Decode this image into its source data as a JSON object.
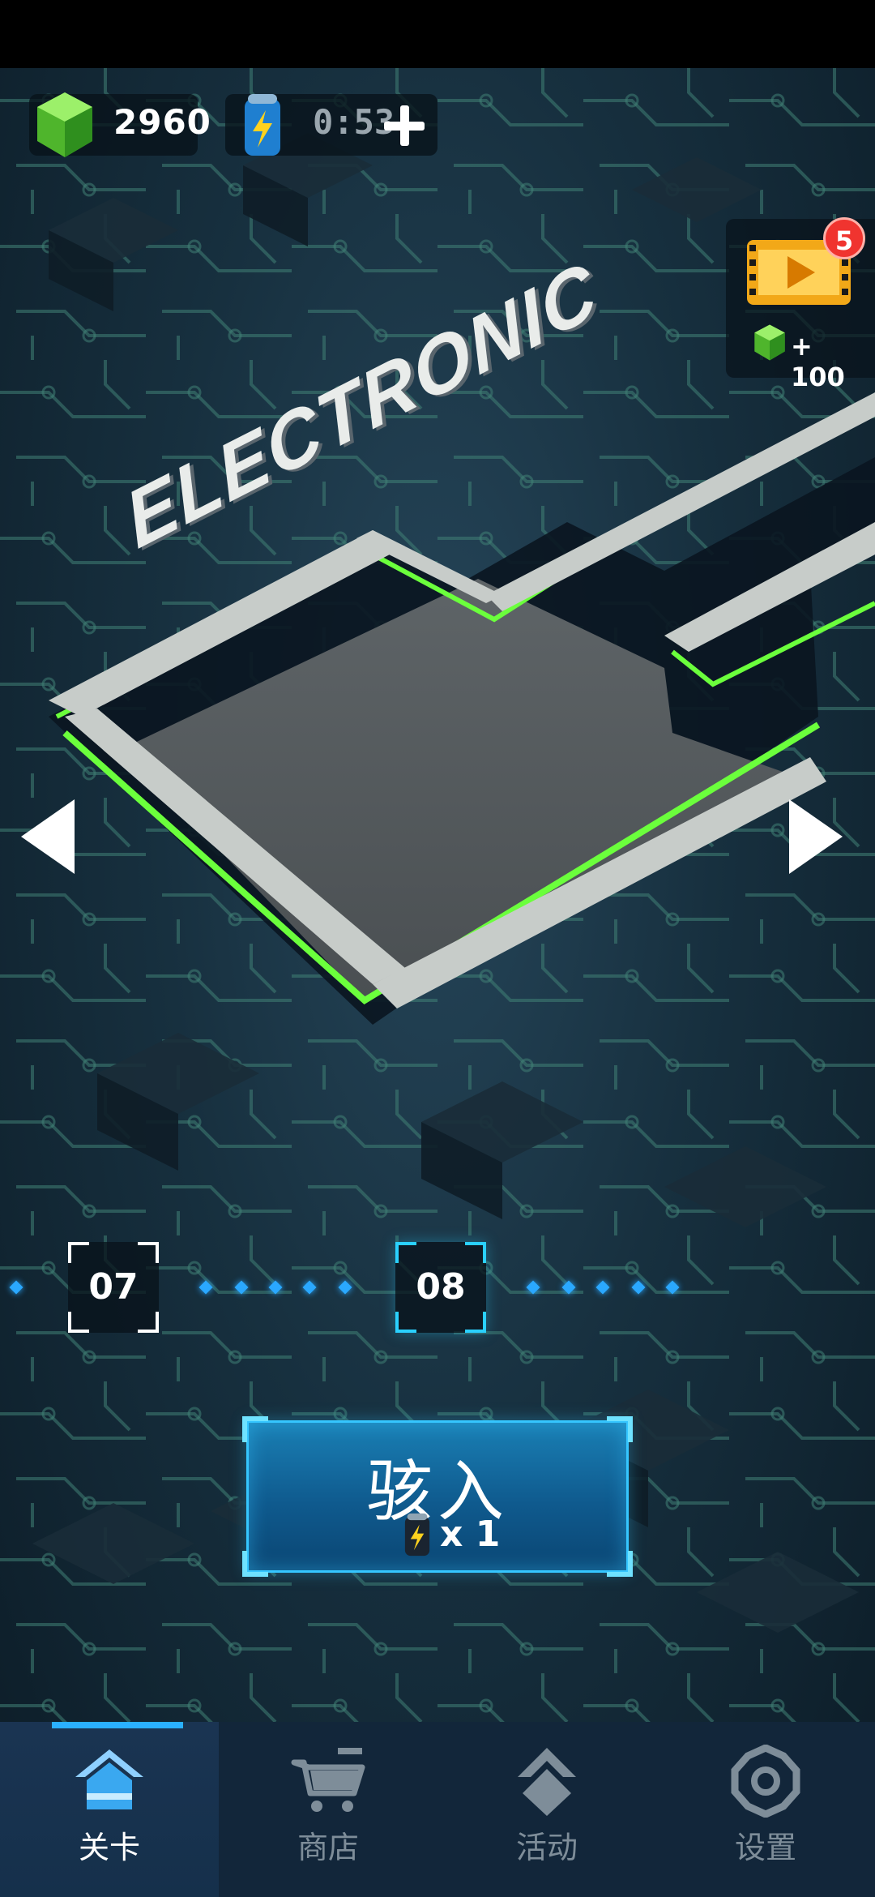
{
  "hud": {
    "gems": "2960",
    "energy_timer": "0:53"
  },
  "reward": {
    "badge": "5",
    "amount": "+ 100"
  },
  "level": {
    "title": "ELECTRONIC",
    "previous": "07",
    "current": "08"
  },
  "start_button": {
    "label": "骇入",
    "cost": "x 1"
  },
  "nav": {
    "items": [
      {
        "label": "关卡"
      },
      {
        "label": "商店"
      },
      {
        "label": "活动"
      },
      {
        "label": "设置"
      }
    ]
  },
  "colors": {
    "accent": "#2ab0ff",
    "glow_green": "#6bff3c",
    "gem_green": "#6fdc3a",
    "badge_red": "#f0342f"
  }
}
